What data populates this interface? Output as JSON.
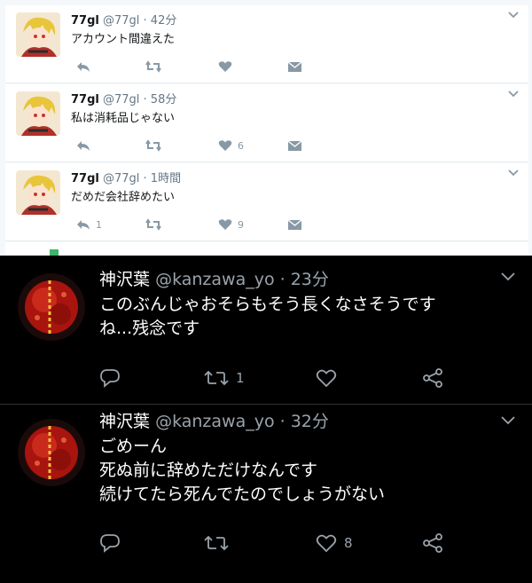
{
  "light_tweets": [
    {
      "display_name": "77gl",
      "meta": "@77gl · 42分",
      "text": "アカウント間違えた",
      "reply_count": "",
      "like_count": ""
    },
    {
      "display_name": "77gl",
      "meta": "@77gl · 58分",
      "text": "私は消耗品じゃない",
      "reply_count": "",
      "like_count": "6"
    },
    {
      "display_name": "77gl",
      "meta": "@77gl · 1時間",
      "text": "だめだ会社辞めたい",
      "reply_count": "1",
      "like_count": "9"
    }
  ],
  "dark_tweets": [
    {
      "display_name": "神沢葉",
      "meta": "@kanzawa_yo · 23分",
      "lines": [
        "このぶんじゃおそらもそう長くなさそうです",
        "ね...残念です"
      ],
      "retweet_count": "1",
      "like_count": ""
    },
    {
      "display_name": "神沢葉",
      "meta": "@kanzawa_yo · 32分",
      "lines": [
        "ごめーん",
        "死ぬ前に辞めただけなんです",
        "続けてたら死んでたのでしょうがない"
      ],
      "retweet_count": "",
      "like_count": "8"
    }
  ],
  "colors": {
    "light_icon": "#8899a6",
    "dark_icon": "#9aa3ab",
    "dark_bg": "#000000",
    "light_bg": "#f5f8fa"
  },
  "icons": [
    "reply-icon",
    "retweet-icon",
    "like-icon",
    "message-icon",
    "share-icon",
    "chevron-down-icon"
  ]
}
